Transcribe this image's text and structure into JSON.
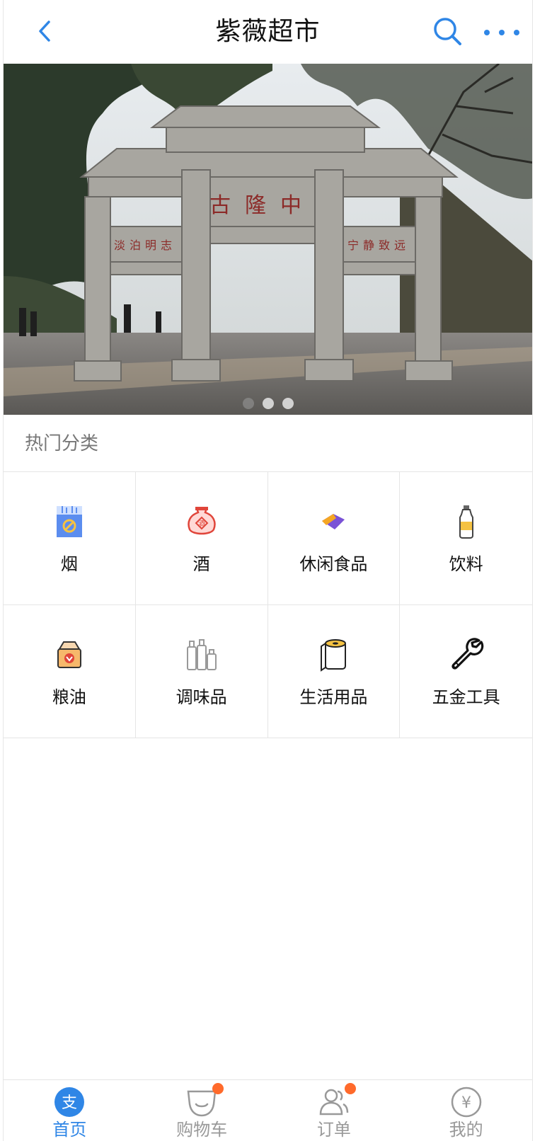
{
  "header": {
    "title": "紫薇超市",
    "icons": {
      "back": "chevron-left-icon",
      "search": "search-icon",
      "more": "more-dots-icon"
    },
    "accent_color": "#2f86e6"
  },
  "banner": {
    "image": "memorial-stone-archway-photo",
    "archway_text": "古隆中",
    "slides": 3,
    "active_slide": 1
  },
  "categories": {
    "title": "热门分类",
    "items": [
      {
        "label": "烟",
        "icon": "cigarette-pack-icon"
      },
      {
        "label": "酒",
        "icon": "liquor-jar-icon"
      },
      {
        "label": "休闲食品",
        "icon": "snack-bag-icon"
      },
      {
        "label": "饮料",
        "icon": "drink-bottle-icon"
      },
      {
        "label": "粮油",
        "icon": "grain-sack-icon"
      },
      {
        "label": "调味品",
        "icon": "condiment-bottles-icon"
      },
      {
        "label": "生活用品",
        "icon": "paper-roll-icon"
      },
      {
        "label": "五金工具",
        "icon": "wrench-icon"
      }
    ]
  },
  "tabbar": {
    "items": [
      {
        "label": "首页",
        "icon": "alipay-home-icon",
        "active": true
      },
      {
        "label": "购物车",
        "icon": "cart-icon",
        "badge": true
      },
      {
        "label": "订单",
        "icon": "orders-icon",
        "badge": true
      },
      {
        "label": "我的",
        "icon": "yuan-icon"
      }
    ],
    "badge_color": "#ff6a2b"
  }
}
